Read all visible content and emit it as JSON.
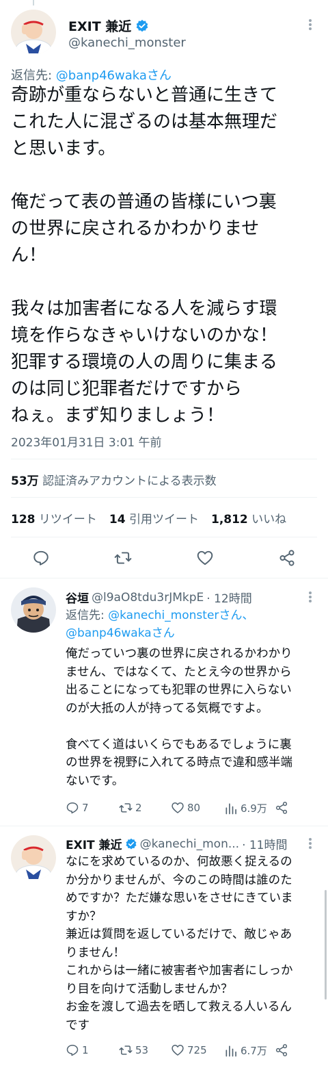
{
  "main": {
    "display_name": "EXIT 兼近",
    "handle": "@kanechi_monster",
    "reply_prefix": "返信先: ",
    "reply_to": "@banp46wakaさん",
    "text": "奇跡が重ならないと普通に生きて\nこれた人に混ざるのは基本無理だ\nと思います。\n\n俺だって表の普通の皆様にいつ裏\nの世界に戻されるかわかりませ\nん！\n\n我々は加害者になる人を減らす環\n境を作らなきゃいけないのかな！\n犯罪する環境の人の周りに集まる\nのは同じ犯罪者だけですから\nねぇ。まず知りましょう！",
    "timestamp": "2023年01月31日 3:01 午前",
    "views_count": "53万",
    "views_label": " 認証済みアカウントによる表示数",
    "retweets_count": "128",
    "retweets_label": " リツイート",
    "quotes_count": "14",
    "quotes_label": " 引用ツイート",
    "likes_count": "1,812",
    "likes_label": " いいね"
  },
  "replies": [
    {
      "display_name": "谷垣",
      "handle": "@l9aO8tdu3rJMkpE",
      "time": "· 12時間",
      "reply_prefix": "返信先: ",
      "reply_to": "@kanechi_monsterさん、\n@banp46wakaさん",
      "text": "俺だっていつ裏の世界に戻されるかわかり\nません、ではなくて、たとえ今の世界から\n出ることになっても犯罪の世界に入らない\nのが大抵の人が持ってる気概ですよ。\n\n食べてく道はいくらでもあるでしょうに裏\nの世界を視野に入れてる時点で違和感半端\nないです。",
      "replies": "7",
      "retweets": "2",
      "likes": "80",
      "views": "6.9万"
    },
    {
      "display_name": "EXIT 兼近",
      "handle": "@kanechi_mon...",
      "time": "· 11時間",
      "text": "なにを求めているのか、何故悪く捉えるの\nか分かりませんが、今のこの時間は誰のた\nめですか？ただ嫌な思いをさせにきていま\nすか？\n兼近は質問を返しているだけで、敵じゃあ\nりません！\nこれからは一緒に被害者や加害者にしっか\nり目を向けて活動しませんか？\nお金を渡して過去を晒して救える人いるん\nです",
      "replies": "1",
      "retweets": "53",
      "likes": "725",
      "views": "6.7万"
    }
  ],
  "colors": {
    "accent": "#1d9bf0",
    "text": "#0f1419",
    "muted": "#536471"
  }
}
